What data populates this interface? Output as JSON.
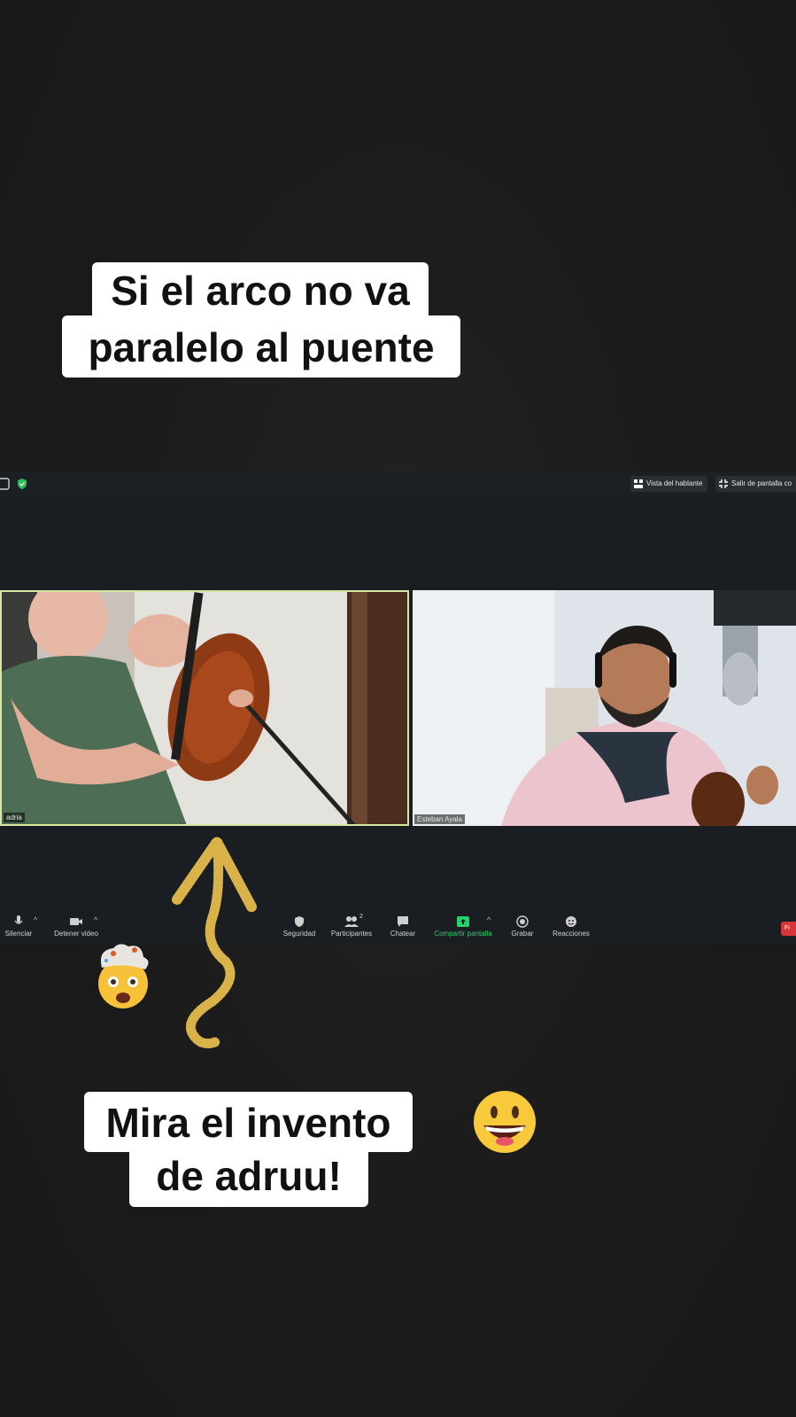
{
  "captions": {
    "top_line1": "Si el arco no va",
    "top_line2": "paralelo al puente",
    "bottom_line1": "Mira el invento",
    "bottom_line2": "de adruu!"
  },
  "topbar": {
    "speaker_view_label": "Vista del hablante",
    "exit_fullscreen_label": "Salir de pantalla co"
  },
  "participants": {
    "left_name": "adria",
    "right_name": "Esteban Ayala"
  },
  "toolbar": {
    "mute_label": "Silenciar",
    "stop_video_label": "Detener video",
    "security_label": "Seguridad",
    "participants_label": "Participantes",
    "participants_count": "2",
    "chat_label": "Chatear",
    "share_screen_label": "Compartir pantalla",
    "record_label": "Grabar",
    "reactions_label": "Reacciones",
    "end_label": "Fi"
  },
  "colors": {
    "share_green": "#24d36b",
    "end_red": "#d8353a",
    "active_speaker_border": "#d8e6a0",
    "arrow_gold": "#d9b34a"
  },
  "stickers": [
    "exploding-head-emoji",
    "grinning-face-emoji",
    "gold-squiggle-arrow"
  ]
}
